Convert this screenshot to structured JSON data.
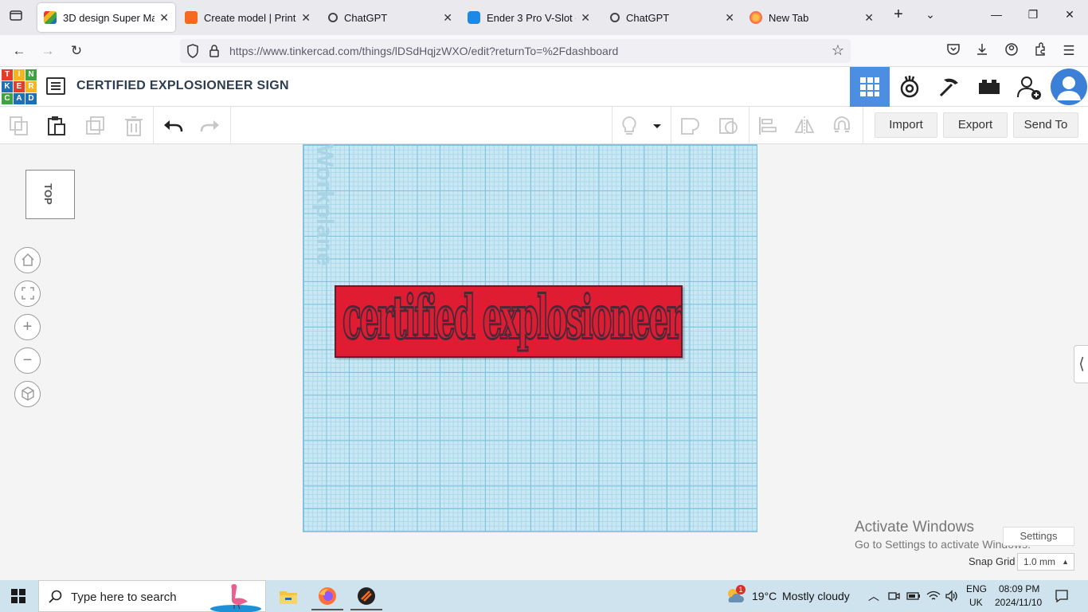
{
  "browser": {
    "tabs": [
      {
        "label": "3D design Super Maim",
        "favicon_color": "#e43e2b",
        "active": true
      },
      {
        "label": "Create model | Printab",
        "favicon_color": "#f36a1f",
        "active": false
      },
      {
        "label": "ChatGPT",
        "favicon_color": "#444444",
        "active": false
      },
      {
        "label": "Ender 3 Pro V-Slot cov",
        "favicon_color": "#1e88e5",
        "active": false
      },
      {
        "label": "ChatGPT",
        "favicon_color": "#444444",
        "active": false
      },
      {
        "label": "New Tab",
        "favicon_color": "#ff7139",
        "active": false
      }
    ],
    "url_host": "https://www.tinkercad.com",
    "url_path": "/things/lDSdHqjzWXO/edit?returnTo=%2Fdashboard"
  },
  "tinkercad": {
    "logo_letters": [
      "T",
      "I",
      "N",
      "K",
      "E",
      "R",
      "C",
      "A",
      "D"
    ],
    "logo_colors": [
      "#e43e2b",
      "#f6b51e",
      "#3fa33f",
      "#1f6fb2",
      "#e43e2b",
      "#f6b51e",
      "#3fa33f",
      "#1f6fb2",
      "#1f6fb2"
    ],
    "design_title": "CERTIFIED EXPLOSIONEER SIGN",
    "toolbar": {
      "import_label": "Import",
      "export_label": "Export",
      "send_to_label": "Send To"
    },
    "view_cube_label": "TOP",
    "workplane_label": "Workplane",
    "sign_text": "certified explosioneer",
    "snap_grid_label": "Snap Grid",
    "snap_grid_value": "1.0 mm",
    "settings_label": "Settings"
  },
  "activation": {
    "title": "Activate Windows",
    "subtitle": "Go to Settings to activate Windows."
  },
  "taskbar": {
    "search_placeholder": "Type here to search",
    "weather_temp": "19°C",
    "weather_desc": "Mostly cloudy",
    "weather_badge": "1",
    "lang_top": "ENG",
    "lang_bottom": "UK",
    "time": "08:09 PM",
    "date": "2024/11/10"
  }
}
